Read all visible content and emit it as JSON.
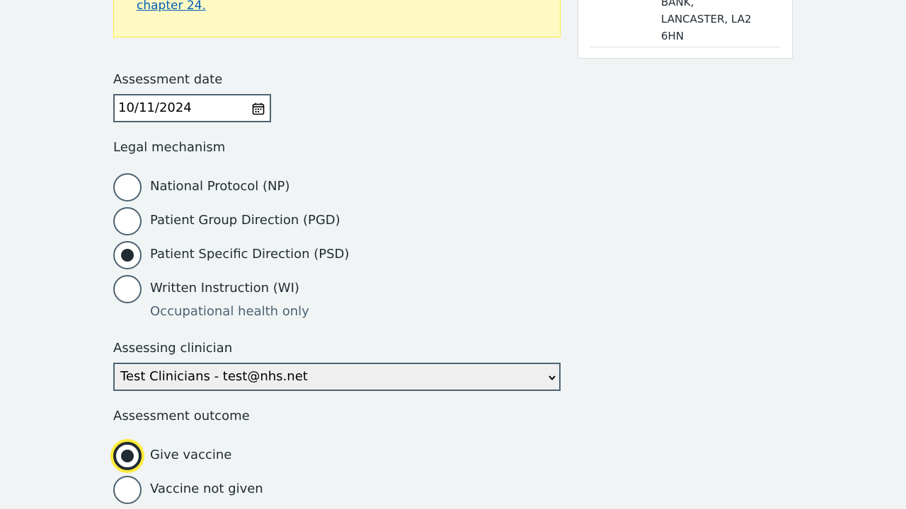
{
  "inset": {
    "link_text": "chapter 24."
  },
  "side_card": {
    "address_lines": [
      "BANK,",
      "LANCASTER, LA2",
      "6HN"
    ]
  },
  "assessment_date": {
    "label": "Assessment date",
    "value": "10/11/2024"
  },
  "legal_mechanism": {
    "label": "Legal mechanism",
    "options": [
      {
        "label": "National Protocol (NP)",
        "checked": false
      },
      {
        "label": "Patient Group Direction (PGD)",
        "checked": false
      },
      {
        "label": "Patient Specific Direction (PSD)",
        "checked": true
      },
      {
        "label": "Written Instruction (WI)",
        "checked": false,
        "hint": "Occupational health only"
      }
    ]
  },
  "assessing_clinician": {
    "label": "Assessing clinician",
    "selected": "Test Clinicians - test@nhs.net"
  },
  "assessment_outcome": {
    "label": "Assessment outcome",
    "options": [
      {
        "label": "Give vaccine",
        "checked": true,
        "focused": true
      },
      {
        "label": "Vaccine not given",
        "checked": false
      }
    ]
  },
  "colors": {
    "background": "#f0f4f5",
    "link": "#005eb8",
    "focus": "#ffeb3b",
    "inset": "#fff9c4"
  },
  "icons": {
    "date_picker": "calendar-icon",
    "select": "chevron-down-icon"
  }
}
